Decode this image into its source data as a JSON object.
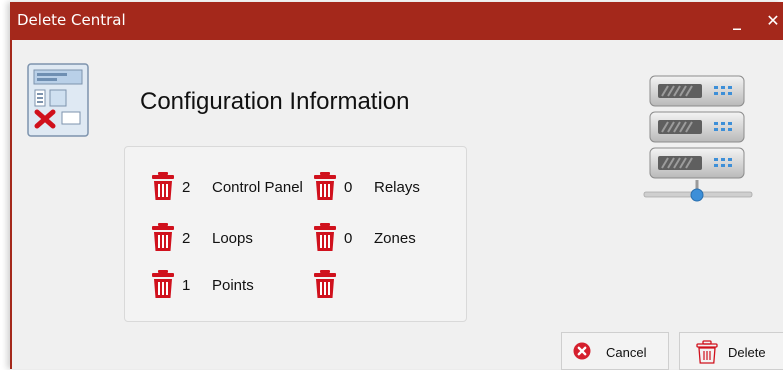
{
  "window": {
    "title": "Delete Central",
    "minimize_glyph": "_",
    "close_glyph": "✕"
  },
  "heading": "Configuration Information",
  "items": [
    {
      "count": "2",
      "label": "Control Panel",
      "icon": "trash-icon"
    },
    {
      "count": "0",
      "label": "Relays",
      "icon": "trash-icon"
    },
    {
      "count": "2",
      "label": "Loops",
      "icon": "trash-icon"
    },
    {
      "count": "0",
      "label": "Zones",
      "icon": "trash-icon"
    },
    {
      "count": "1",
      "label": "Points",
      "icon": "trash-icon"
    },
    {
      "count": "",
      "label": "",
      "icon": "trash-icon"
    }
  ],
  "buttons": {
    "cancel_label": "Cancel",
    "delete_label": "Delete"
  },
  "icons": {
    "central": "control-panel-delete-icon",
    "server": "server-icon",
    "cancel": "cancel-circle-icon",
    "delete": "trash-outline-icon"
  },
  "colors": {
    "titlebar": "#a4281b",
    "trash_red": "#d0111d",
    "window_bg": "#f0f0f0"
  }
}
